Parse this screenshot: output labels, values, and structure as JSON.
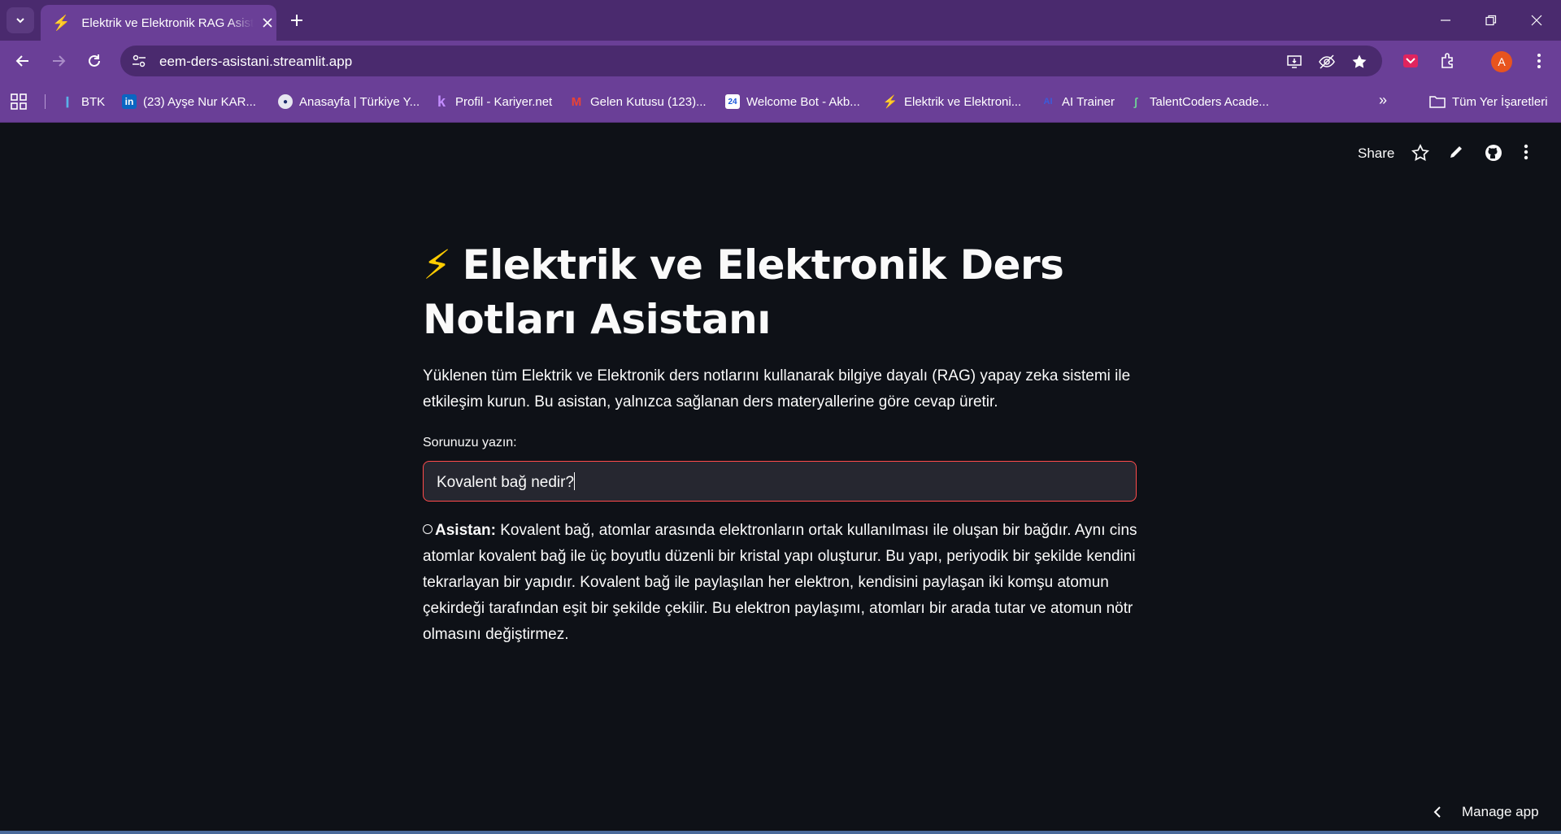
{
  "browser": {
    "tab_title": "Elektrik ve Elektronik RAG Asistanı",
    "url": "eem-ders-asistani.streamlit.app",
    "profile_initial": "A",
    "accent_color": "#6a3f97"
  },
  "bookmarks": {
    "items": [
      {
        "label": "BTK",
        "icon": "btk-icon"
      },
      {
        "label": "(23) Ayşe Nur KAR...",
        "icon": "linkedin-icon"
      },
      {
        "label": "Anasayfa | Türkiye Y...",
        "icon": "globe-icon"
      },
      {
        "label": "Profil - Kariyer.net",
        "icon": "kariyer-icon"
      },
      {
        "label": "Gelen Kutusu (123)...",
        "icon": "gmail-icon"
      },
      {
        "label": "Welcome Bot - Akb...",
        "icon": "calendar-icon"
      },
      {
        "label": "Elektrik ve Elektroni...",
        "icon": "lightning-icon"
      },
      {
        "label": "AI Trainer",
        "icon": "ai-icon"
      },
      {
        "label": "TalentCoders Acade...",
        "icon": "talentcoders-icon"
      }
    ],
    "all_bookmarks": "Tüm Yer İşaretleri"
  },
  "app": {
    "header": {
      "share": "Share"
    },
    "title_emoji": "⚡",
    "title": "Elektrik ve Elektronik Ders Notları Asistanı",
    "description": "Yüklenen tüm Elektrik ve Elektronik ders notlarını kullanarak bilgiye dayalı (RAG) yapay zeka sistemi ile etkileşim kurun. Bu asistan, yalnızca sağlanan ders materyallerine göre cevap üretir.",
    "input_label": "Sorunuzu yazın:",
    "input_value": "Kovalent bağ nedir?",
    "answer_prefix": "Asistan:",
    "answer_text": "Kovalent bağ, atomlar arasında elektronların ortak kullanılması ile oluşan bir bağdır. Aynı cins atomlar kovalent bağ ile üç boyutlu düzenli bir kristal yapı oluşturur. Bu yapı, periyodik bir şekilde kendini tekrarlayan bir yapıdır. Kovalent bağ ile paylaşılan her elektron, kendisini paylaşan iki komşu atomun çekirdeği tarafından eşit bir şekilde çekilir. Bu elektron paylaşımı, atomları bir arada tutar ve atomun nötr olmasını değiştirmez.",
    "manage_app": "Manage app",
    "input_border_color": "#ff4b4b"
  }
}
